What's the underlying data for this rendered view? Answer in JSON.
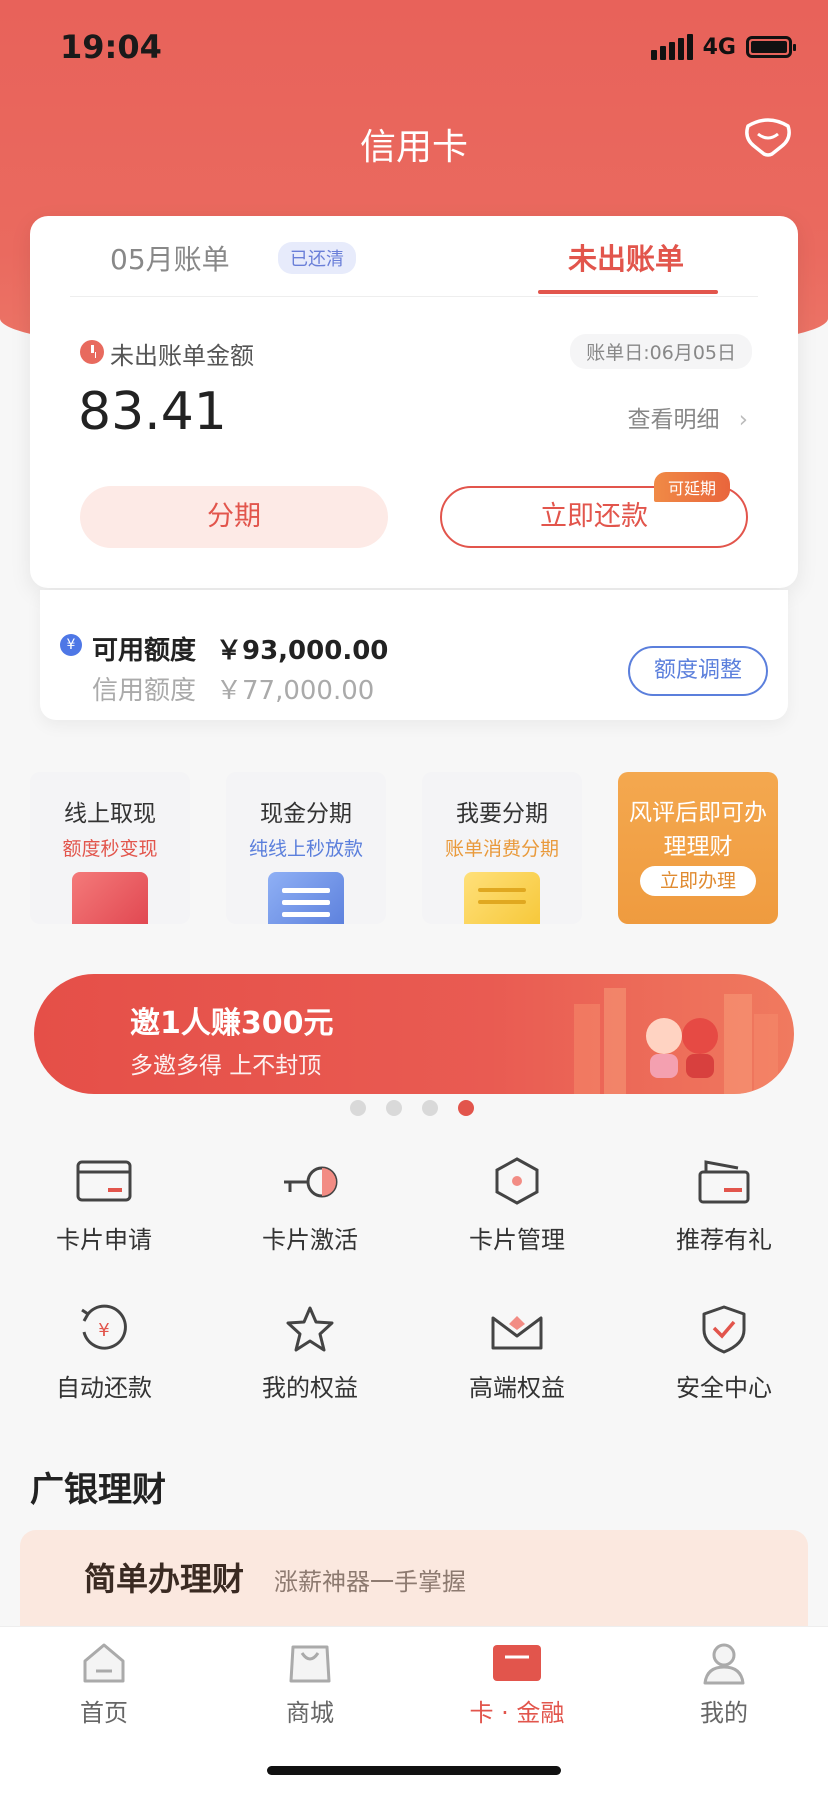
{
  "status_bar": {
    "time": "19:04",
    "network": "4G"
  },
  "header": {
    "title": "信用卡"
  },
  "bill": {
    "tab_prev": "05月账单",
    "tab_prev_badge": "已还清",
    "tab_current": "未出账单",
    "unbilled_label": "未出账单金额",
    "bill_date": "账单日:06月05日",
    "amount": "83.41",
    "detail_link": "查看明细",
    "installment_button": "分期",
    "repay_button": "立即还款",
    "repay_badge": "可延期"
  },
  "credit": {
    "available_label": "可用额度",
    "available_value": "￥93,000.00",
    "limit_label": "信用额度",
    "limit_value": "￥77,000.00",
    "adjust_button": "额度调整"
  },
  "tiles": [
    {
      "title": "线上取现",
      "subtitle": "额度秒变现",
      "sub_color": "#e2554c"
    },
    {
      "title": "现金分期",
      "subtitle": "纯线上秒放款",
      "sub_color": "#5b7fdc"
    },
    {
      "title": "我要分期",
      "subtitle": "账单消费分期",
      "sub_color": "#e99a3c"
    }
  ],
  "promo_tile": {
    "title": "风评后即可办理理财",
    "button": "立即办理"
  },
  "banner": {
    "title": "邀1人赚300元",
    "subtitle": "多邀多得 上不封顶",
    "active_slide": 4,
    "slide_count": 4
  },
  "grid": [
    {
      "label": "卡片申请",
      "icon": "card-apply-icon"
    },
    {
      "label": "卡片激活",
      "icon": "card-activate-icon"
    },
    {
      "label": "卡片管理",
      "icon": "card-manage-icon"
    },
    {
      "label": "推荐有礼",
      "icon": "referral-gift-icon"
    },
    {
      "label": "自动还款",
      "icon": "auto-repay-icon"
    },
    {
      "label": "我的权益",
      "icon": "star-icon"
    },
    {
      "label": "高端权益",
      "icon": "premium-envelope-icon"
    },
    {
      "label": "安全中心",
      "icon": "shield-check-icon"
    }
  ],
  "finance": {
    "section_title": "广银理财",
    "card_title": "简单办理财",
    "card_subtitle": "涨薪神器一手掌握"
  },
  "nav": {
    "items": [
      {
        "label": "首页",
        "icon": "home-icon"
      },
      {
        "label": "商城",
        "icon": "shopping-bag-icon"
      },
      {
        "label": "卡 · 金融",
        "icon": "card-finance-icon",
        "active": true
      },
      {
        "label": "我的",
        "icon": "profile-icon"
      }
    ]
  },
  "colors": {
    "brand_red": "#e2554c",
    "accent_blue": "#5b7fdc",
    "accent_orange": "#ef9b3f"
  }
}
